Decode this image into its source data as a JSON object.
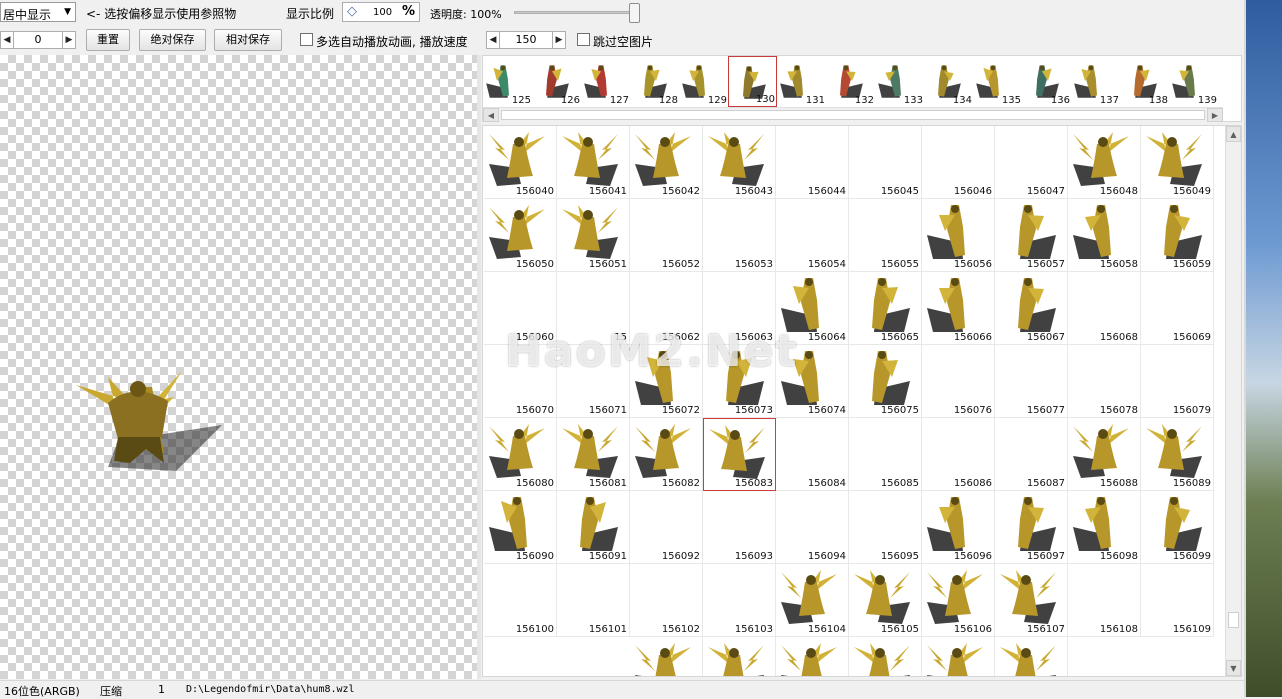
{
  "toolbar": {
    "mode_select": "居中显示",
    "hint": "<- 选按偏移显示使用参照物",
    "ratio_label": "显示比例",
    "ratio_value": "100",
    "percent_sign": "%",
    "opacity_label": "透明度: 100%",
    "opacity_fraction": 1.0,
    "offset_value": "0",
    "reset_button": "重置",
    "abs_save_button": "绝对保存",
    "rel_save_button": "相对保存",
    "auto_play_label": "多选自动播放动画, 播放速度",
    "speed_value": "150",
    "skip_empty_label": "跳过空图片"
  },
  "thumbnails": [
    "125",
    "126",
    "127",
    "128",
    "129",
    "130",
    "131",
    "132",
    "133",
    "134",
    "135",
    "136",
    "137",
    "138",
    "139"
  ],
  "selected_thumbnail": "130",
  "grid": {
    "rows": [
      [
        "156040",
        "156041",
        "156042",
        "156043",
        "156044",
        "156045",
        "156046",
        "156047",
        "156048",
        "156049"
      ],
      [
        "156050",
        "156051",
        "156052",
        "156053",
        "156054",
        "156055",
        "156056",
        "156057",
        "156058",
        "156059"
      ],
      [
        "156060",
        "15",
        "156062",
        "156063",
        "156064",
        "156065",
        "156066",
        "156067",
        "156068",
        "156069"
      ],
      [
        "156070",
        "156071",
        "156072",
        "156073",
        "156074",
        "156075",
        "156076",
        "156077",
        "156078",
        "156079"
      ],
      [
        "156080",
        "156081",
        "156082",
        "156083",
        "156084",
        "156085",
        "156086",
        "156087",
        "156088",
        "156089"
      ],
      [
        "156090",
        "156091",
        "156092",
        "156093",
        "156094",
        "156095",
        "156096",
        "156097",
        "156098",
        "156099"
      ],
      [
        "156100",
        "156101",
        "156102",
        "156103",
        "156104",
        "156105",
        "156106",
        "156107",
        "156108",
        "156109"
      ]
    ],
    "selected": "156083",
    "watermark": "HaoM2.Net"
  },
  "status": {
    "color_mode": "16位色(ARGB)",
    "compression": "压缩",
    "count": "1",
    "path": "D:\\Legendofmir\\Data\\hum8.wzl"
  },
  "colors": {
    "selection_border": "#d23c3c",
    "sprite_gold": "#b8972a",
    "sprite_dark": "#5a4a14"
  }
}
